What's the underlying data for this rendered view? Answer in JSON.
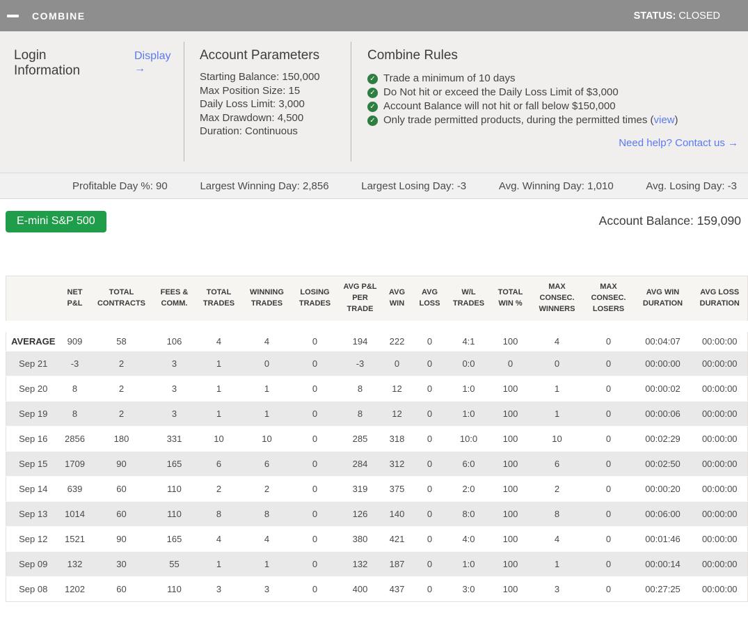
{
  "topbar": {
    "title": "COMBINE",
    "status_label": "STATUS:",
    "status_value": "CLOSED"
  },
  "login": {
    "title": "Login Information",
    "display_link": "Display →"
  },
  "account_parameters": {
    "title": "Account Parameters",
    "items": [
      "Starting Balance: 150,000",
      "Max Position Size: 15",
      "Daily Loss Limit: 3,000",
      "Max Drawdown: 4,500",
      "Duration: Continuous"
    ]
  },
  "combine_rules": {
    "title": "Combine Rules",
    "check_icon": "✓",
    "rules": [
      {
        "text": "Trade a minimum of 10 days"
      },
      {
        "text": "Do Not hit or exceed the Daily Loss Limit of $3,000"
      },
      {
        "text": "Account Balance will not hit or fall below $150,000"
      },
      {
        "text": "Only trade permitted products, during the permitted times (",
        "link": "view",
        "suffix": ")"
      }
    ],
    "help_link": "Need help? Contact us →"
  },
  "stats": [
    "Profitable Day %: 90",
    "Largest Winning Day: 2,856",
    "Largest Losing Day: -3",
    "Avg. Winning Day: 1,010",
    "Avg. Losing Day: -3"
  ],
  "account": {
    "product_button": "E-mini S&P 500",
    "balance": "Account Balance: 159,090"
  },
  "colors": {
    "topbar_gray": "#8e8e8e",
    "button_green": "#1f9d4a",
    "check_green": "#2e7d41",
    "link_blue": "#5b79f2"
  },
  "table": {
    "columns": [
      "",
      "NET P&L",
      "TOTAL CONTRACTS",
      "FEES & COMM.",
      "TOTAL TRADES",
      "WINNING TRADES",
      "LOSING TRADES",
      "AVG P&L PER TRADE",
      "AVG WIN",
      "AVG LOSS",
      "W/L TRADES",
      "TOTAL WIN %",
      "MAX CONSEC. WINNERS",
      "MAX CONSEC. LOSERS",
      "AVG WIN DURATION",
      "AVG LOSS DURATION"
    ],
    "rows": [
      {
        "label": "AVERAGE",
        "values": [
          "909",
          "58",
          "106",
          "4",
          "4",
          "0",
          "194",
          "222",
          "0",
          "4:1",
          "100",
          "4",
          "0",
          "00:04:07",
          "00:00:00"
        ]
      },
      {
        "label": "Sep 21",
        "values": [
          "-3",
          "2",
          "3",
          "1",
          "0",
          "0",
          "-3",
          "0",
          "0",
          "0:0",
          "0",
          "0",
          "0",
          "00:00:00",
          "00:00:00"
        ]
      },
      {
        "label": "Sep 20",
        "values": [
          "8",
          "2",
          "3",
          "1",
          "1",
          "0",
          "8",
          "12",
          "0",
          "1:0",
          "100",
          "1",
          "0",
          "00:00:02",
          "00:00:00"
        ]
      },
      {
        "label": "Sep 19",
        "values": [
          "8",
          "2",
          "3",
          "1",
          "1",
          "0",
          "8",
          "12",
          "0",
          "1:0",
          "100",
          "1",
          "0",
          "00:00:06",
          "00:00:00"
        ]
      },
      {
        "label": "Sep 16",
        "values": [
          "2856",
          "180",
          "331",
          "10",
          "10",
          "0",
          "285",
          "318",
          "0",
          "10:0",
          "100",
          "10",
          "0",
          "00:02:29",
          "00:00:00"
        ]
      },
      {
        "label": "Sep 15",
        "values": [
          "1709",
          "90",
          "165",
          "6",
          "6",
          "0",
          "284",
          "312",
          "0",
          "6:0",
          "100",
          "6",
          "0",
          "00:02:50",
          "00:00:00"
        ]
      },
      {
        "label": "Sep 14",
        "values": [
          "639",
          "60",
          "110",
          "2",
          "2",
          "0",
          "319",
          "375",
          "0",
          "2:0",
          "100",
          "2",
          "0",
          "00:00:20",
          "00:00:00"
        ]
      },
      {
        "label": "Sep 13",
        "values": [
          "1014",
          "60",
          "110",
          "8",
          "8",
          "0",
          "126",
          "140",
          "0",
          "8:0",
          "100",
          "8",
          "0",
          "00:06:00",
          "00:00:00"
        ]
      },
      {
        "label": "Sep 12",
        "values": [
          "1521",
          "90",
          "165",
          "4",
          "4",
          "0",
          "380",
          "421",
          "0",
          "4:0",
          "100",
          "4",
          "0",
          "00:01:46",
          "00:00:00"
        ]
      },
      {
        "label": "Sep 09",
        "values": [
          "132",
          "30",
          "55",
          "1",
          "1",
          "0",
          "132",
          "187",
          "0",
          "1:0",
          "100",
          "1",
          "0",
          "00:00:14",
          "00:00:00"
        ]
      },
      {
        "label": "Sep 08",
        "values": [
          "1202",
          "60",
          "110",
          "3",
          "3",
          "0",
          "400",
          "437",
          "0",
          "3:0",
          "100",
          "3",
          "0",
          "00:27:25",
          "00:00:00"
        ]
      }
    ]
  }
}
